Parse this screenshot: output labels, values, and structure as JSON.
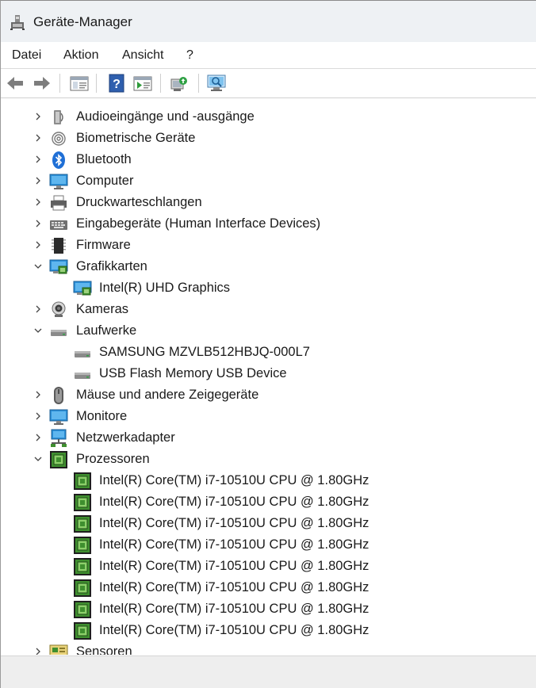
{
  "window": {
    "title": "Geräte-Manager"
  },
  "menu": [
    "Datei",
    "Aktion",
    "Ansicht",
    "?"
  ],
  "toolbar": {
    "buttons": [
      "back-arrow-icon",
      "forward-arrow-icon",
      "properties-window-icon",
      "help-icon",
      "update-driver-icon",
      "scan-hardware-changes-icon",
      "monitor-view-icon"
    ]
  },
  "tree": {
    "categories": [
      {
        "label": "Audioeingänge und -ausgänge",
        "expanded": false,
        "icon": "speaker-icon"
      },
      {
        "label": "Biometrische Geräte",
        "expanded": false,
        "icon": "fingerprint-icon"
      },
      {
        "label": "Bluetooth",
        "expanded": false,
        "icon": "bluetooth-icon"
      },
      {
        "label": "Computer",
        "expanded": false,
        "icon": "computer-icon"
      },
      {
        "label": "Druckwarteschlangen",
        "expanded": false,
        "icon": "printer-icon"
      },
      {
        "label": "Eingabegeräte (Human Interface Devices)",
        "expanded": false,
        "icon": "keyboard-icon"
      },
      {
        "label": "Firmware",
        "expanded": false,
        "icon": "chip-icon"
      },
      {
        "label": "Grafikkarten",
        "expanded": true,
        "icon": "display-adapter-icon",
        "children": [
          {
            "label": "Intel(R) UHD Graphics",
            "icon": "display-adapter-icon"
          }
        ]
      },
      {
        "label": "Kameras",
        "expanded": false,
        "icon": "webcam-icon"
      },
      {
        "label": "Laufwerke",
        "expanded": true,
        "icon": "drive-icon",
        "children": [
          {
            "label": "SAMSUNG MZVLB512HBJQ-000L7",
            "icon": "drive-icon"
          },
          {
            "label": "USB Flash Memory USB Device",
            "icon": "drive-icon"
          }
        ]
      },
      {
        "label": "Mäuse und andere Zeigegeräte",
        "expanded": false,
        "icon": "mouse-icon"
      },
      {
        "label": "Monitore",
        "expanded": false,
        "icon": "monitor-icon"
      },
      {
        "label": "Netzwerkadapter",
        "expanded": false,
        "icon": "network-adapter-icon"
      },
      {
        "label": "Prozessoren",
        "expanded": true,
        "icon": "processor-icon",
        "children": [
          {
            "label": "Intel(R) Core(TM) i7-10510U CPU @ 1.80GHz",
            "icon": "processor-icon"
          },
          {
            "label": "Intel(R) Core(TM) i7-10510U CPU @ 1.80GHz",
            "icon": "processor-icon"
          },
          {
            "label": "Intel(R) Core(TM) i7-10510U CPU @ 1.80GHz",
            "icon": "processor-icon"
          },
          {
            "label": "Intel(R) Core(TM) i7-10510U CPU @ 1.80GHz",
            "icon": "processor-icon"
          },
          {
            "label": "Intel(R) Core(TM) i7-10510U CPU @ 1.80GHz",
            "icon": "processor-icon"
          },
          {
            "label": "Intel(R) Core(TM) i7-10510U CPU @ 1.80GHz",
            "icon": "processor-icon"
          },
          {
            "label": "Intel(R) Core(TM) i7-10510U CPU @ 1.80GHz",
            "icon": "processor-icon"
          },
          {
            "label": "Intel(R) Core(TM) i7-10510U CPU @ 1.80GHz",
            "icon": "processor-icon"
          }
        ]
      },
      {
        "label": "Sensoren",
        "expanded": false,
        "icon": "sensor-icon"
      }
    ]
  },
  "colors": {
    "titlebar": "#eef1f4",
    "statusbar": "#eeeeee",
    "chip_green": "#3f8f2f",
    "monitor_blue": "#1e90d8"
  }
}
